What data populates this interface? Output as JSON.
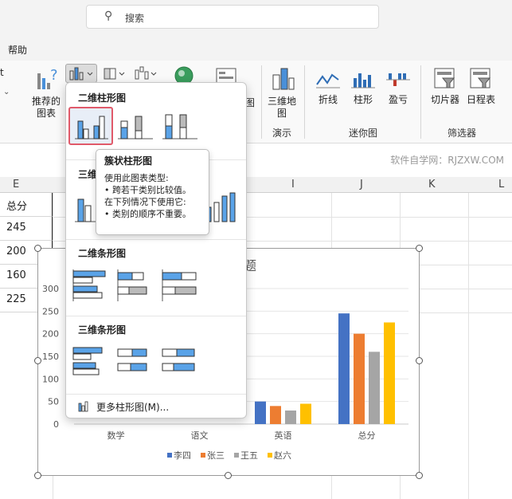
{
  "search": {
    "placeholder": "搜索"
  },
  "menu": {
    "help": "帮助"
  },
  "ribbon": {
    "left_partial": "t",
    "recommended": "推荐的",
    "recommended2": "图表",
    "map3d": "三维地",
    "map3d2": "图",
    "line": "折线",
    "column": "柱形",
    "winloss": "盈亏",
    "slicer": "切片器",
    "timeline": "日程表",
    "group_demo": "演示",
    "group_sparkline": "迷你图",
    "group_filter": "筛选器",
    "partial_map": "图"
  },
  "watermark": "软件自学网：RJZXW.COM",
  "columns": [
    "E",
    "I",
    "J",
    "K",
    "L"
  ],
  "cells": [
    "总分",
    "245",
    "200",
    "160",
    "225"
  ],
  "dropdown": {
    "sec_2d_column": "二维柱形图",
    "sec_3d_column_partial": "三维",
    "sec_2d_bar": "二维条形图",
    "sec_3d_bar": "三维条形图",
    "more": "更多柱形图(M)..."
  },
  "tooltip": {
    "title": "簇状柱形图",
    "line1": "使用此图表类型:",
    "line2": "• 跨若干类别比较值。",
    "line3": "在下列情况下使用它:",
    "line4": "• 类别的顺序不重要。"
  },
  "chart": {
    "title_partial": "题",
    "y_ticks": [
      "300",
      "250",
      "200",
      "150",
      "100",
      "50",
      "0"
    ],
    "legend": [
      "李四",
      "张三",
      "王五",
      "赵六"
    ]
  },
  "chart_data": {
    "type": "bar",
    "title": "题",
    "categories": [
      "数学",
      "语文",
      "英语",
      "总分"
    ],
    "series": [
      {
        "name": "李四",
        "values": [
          null,
          null,
          50,
          245
        ]
      },
      {
        "name": "张三",
        "values": [
          null,
          null,
          40,
          200
        ]
      },
      {
        "name": "王五",
        "values": [
          null,
          null,
          30,
          160
        ]
      },
      {
        "name": "赵六",
        "values": [
          null,
          null,
          45,
          225
        ]
      }
    ],
    "colors": [
      "#4472c4",
      "#ed7d31",
      "#a5a5a5",
      "#ffc000"
    ],
    "ylim": [
      0,
      300
    ],
    "legend_position": "bottom"
  }
}
